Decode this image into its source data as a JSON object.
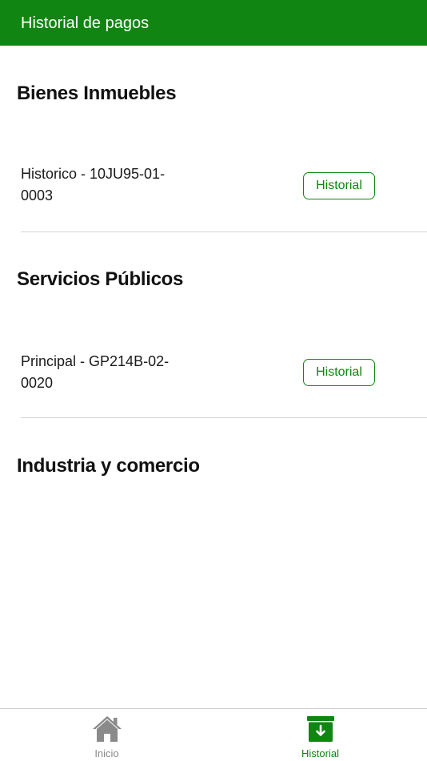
{
  "header": {
    "title": "Historial de pagos"
  },
  "sections": [
    {
      "title": "Bienes Inmuebles",
      "items": [
        {
          "label": "Historico - 10JU95-01-0003",
          "button_label": "Historial"
        }
      ]
    },
    {
      "title": "Servicios Públicos",
      "items": [
        {
          "label": "Principal - GP214B-02-0020",
          "button_label": "Historial"
        }
      ]
    },
    {
      "title": "Industria y comercio",
      "items": []
    }
  ],
  "bottom_nav": {
    "items": [
      {
        "label": "Inicio",
        "icon": "home-icon",
        "active": false
      },
      {
        "label": "Historial",
        "icon": "archive-download-icon",
        "active": true
      }
    ]
  },
  "colors": {
    "primary": "#118512",
    "inactive": "#8a8a8a",
    "divider": "#d4d4d4"
  }
}
